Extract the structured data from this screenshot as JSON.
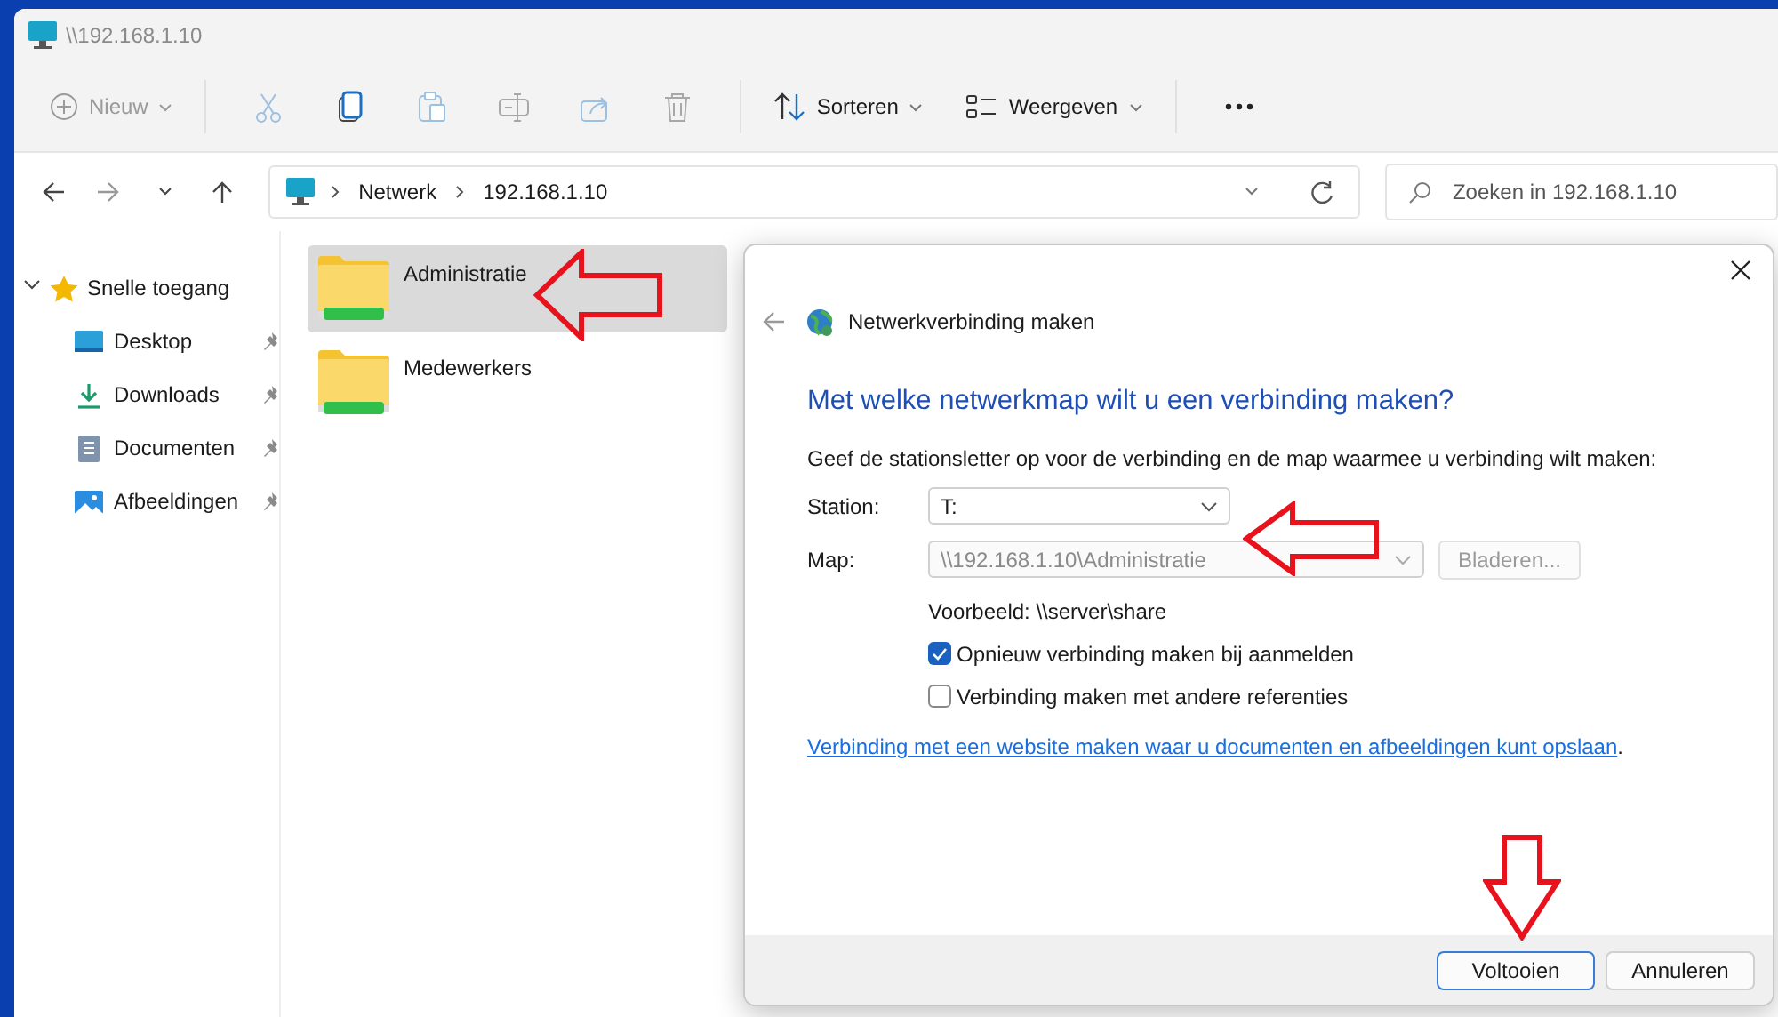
{
  "window": {
    "title": "\\\\192.168.1.10"
  },
  "toolbar": {
    "new_button": {
      "label": "Nieuw",
      "disabled": true
    },
    "icon_buttons": [
      {
        "kind": "cut",
        "disabled": true
      },
      {
        "kind": "copy",
        "disabled": false
      },
      {
        "kind": "paste",
        "disabled": true
      },
      {
        "kind": "rename",
        "disabled": true
      },
      {
        "kind": "share",
        "disabled": true
      },
      {
        "kind": "delete",
        "disabled": true
      }
    ],
    "sort_button": {
      "label": "Sorteren"
    },
    "view_button": {
      "label": "Weergeven"
    }
  },
  "address_bar": {
    "segments": [
      "Netwerk",
      "192.168.1.10"
    ]
  },
  "search": {
    "placeholder": "Zoeken in 192.168.1.10"
  },
  "sidebar": {
    "label": "Snelle toegang",
    "expanded": true,
    "children": [
      {
        "label": "Desktop",
        "kind": "desktop",
        "pinned": true
      },
      {
        "label": "Downloads",
        "kind": "downloads",
        "pinned": true
      },
      {
        "label": "Documenten",
        "kind": "documents",
        "pinned": true
      },
      {
        "label": "Afbeeldingen",
        "kind": "pictures",
        "pinned": true
      }
    ]
  },
  "files": [
    {
      "name": "Administratie",
      "selected": true
    },
    {
      "name": "Medewerkers",
      "selected": false
    }
  ],
  "dialog": {
    "title": "Netwerkverbinding maken",
    "heading": "Met welke netwerkmap wilt u een verbinding maken?",
    "instruction": "Geef de stationsletter op voor de verbinding en de map waarmee u verbinding wilt maken:",
    "station": {
      "label": "Station:",
      "value": "T:"
    },
    "folder": {
      "label": "Map:",
      "value": "\\\\192.168.1.10\\Administratie",
      "disabled": true
    },
    "browse_button": {
      "label": "Bladeren...",
      "disabled": true
    },
    "example": "Voorbeeld: \\\\server\\share",
    "options": [
      {
        "label": "Opnieuw verbinding maken bij aanmelden",
        "checked": true
      },
      {
        "label": "Verbinding maken met andere referenties",
        "checked": false
      }
    ],
    "link": {
      "text": "Verbinding met een website maken waar u documenten en afbeeldingen kunt opslaan",
      "suffix": "."
    },
    "buttons": [
      {
        "label": "Voltooien",
        "default": true
      },
      {
        "label": "Annuleren",
        "default": false
      }
    ]
  }
}
